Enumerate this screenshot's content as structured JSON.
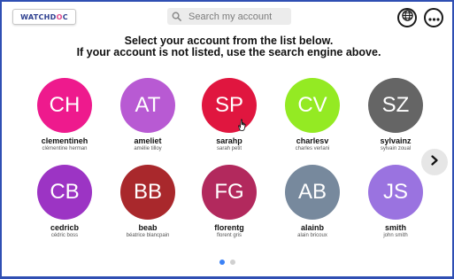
{
  "brand": {
    "logo_text_a": "WATCHD",
    "logo_text_o": "O",
    "logo_text_b": "C"
  },
  "search": {
    "placeholder": "Search my account",
    "value": ""
  },
  "header": {
    "line1": "Select your account from the list below.",
    "line2": "If your account is not listed, use the search engine above."
  },
  "toolbar": {
    "language_icon": "globe-icon",
    "more_icon": "more-horizontal-icon"
  },
  "accounts": [
    {
      "initials": "CH",
      "username": "clementineh",
      "fullname": "clémentine herman",
      "color": "#ee1a8d"
    },
    {
      "initials": "AT",
      "username": "ameliet",
      "fullname": "amélie tilloy",
      "color": "#b85ad3"
    },
    {
      "initials": "SP",
      "username": "sarahp",
      "fullname": "sarah petit",
      "color": "#e0163f"
    },
    {
      "initials": "CV",
      "username": "charlesv",
      "fullname": "charles verlani",
      "color": "#94ea23"
    },
    {
      "initials": "SZ",
      "username": "sylvainz",
      "fullname": "sylvain zoual",
      "color": "#656565"
    },
    {
      "initials": "CB",
      "username": "cedricb",
      "fullname": "cédric boss",
      "color": "#9c34c4"
    },
    {
      "initials": "BB",
      "username": "beab",
      "fullname": "béatrice blancpain",
      "color": "#a9282c"
    },
    {
      "initials": "FG",
      "username": "florentg",
      "fullname": "florent gris",
      "color": "#b2295d"
    },
    {
      "initials": "AB",
      "username": "alainb",
      "fullname": "alain bricoux",
      "color": "#77899d"
    },
    {
      "initials": "JS",
      "username": "smith",
      "fullname": "john smith",
      "color": "#9a73e0"
    }
  ],
  "pagination": {
    "pages": 2,
    "current": 1,
    "next_icon": "chevron-right-icon"
  },
  "cursor": {
    "icon": "hand-pointer-icon",
    "over": "sarahp"
  }
}
